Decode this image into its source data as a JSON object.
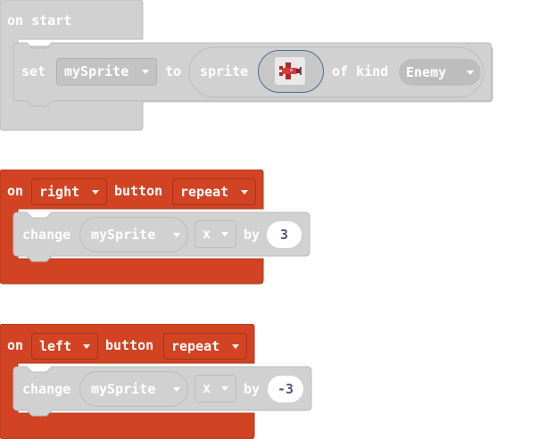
{
  "colors": {
    "sprites_block": "#d1d1d1",
    "sprites_border": "#bcbcbc",
    "sprites_inner_dd": "#c3c3c3",
    "controller_block": "#d24323",
    "controller_border": "#b0381c",
    "slot_bg": "#c7c7c7",
    "image_frame": "#4a6a9a"
  },
  "block1": {
    "hat_label": "on start",
    "set_label": "set",
    "var_value": "mySprite",
    "to_label": "to",
    "sprite_label": "sprite",
    "image_icon": "red-airplane-icon",
    "of_kind_label": "of kind",
    "kind_value": "Enemy"
  },
  "block2": {
    "on_label": "on",
    "button_value": "right",
    "button_label": "button",
    "event_value": "repeat",
    "change_label": "change",
    "var_value": "mySprite",
    "prop_value": "x",
    "by_label": "by",
    "amount": "3"
  },
  "block3": {
    "on_label": "on",
    "button_value": "left",
    "button_label": "button",
    "event_value": "repeat",
    "change_label": "change",
    "var_value": "mySprite",
    "prop_value": "x",
    "by_label": "by",
    "amount": "-3"
  }
}
